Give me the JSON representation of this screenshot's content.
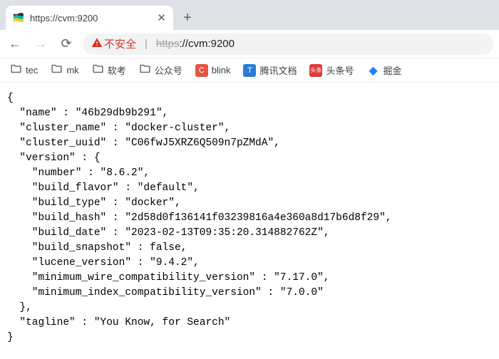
{
  "tab": {
    "title": "https://cvm:9200"
  },
  "address": {
    "warn_label": "不安全",
    "url_scheme": "https",
    "url_rest": "//cvm:9200"
  },
  "bookmarks": [
    {
      "kind": "folder",
      "label": "tec"
    },
    {
      "kind": "folder",
      "label": "mk"
    },
    {
      "kind": "folder",
      "label": "软考"
    },
    {
      "kind": "folder",
      "label": "公众号"
    },
    {
      "kind": "fav",
      "label": "blink",
      "bg": "#e25541",
      "glyph": "C"
    },
    {
      "kind": "fav",
      "label": "腾讯文档",
      "bg": "#2b7cd3",
      "glyph": "T"
    },
    {
      "kind": "fav",
      "label": "头条号",
      "bg": "#e03a3a",
      "glyph": "头条"
    },
    {
      "kind": "fav",
      "label": "掘金",
      "bg": "#1e80ff",
      "glyph": "◆"
    }
  ],
  "json_body": "{\n  \"name\" : \"46b29db9b291\",\n  \"cluster_name\" : \"docker-cluster\",\n  \"cluster_uuid\" : \"C06fwJ5XRZ6Q509n7pZMdA\",\n  \"version\" : {\n    \"number\" : \"8.6.2\",\n    \"build_flavor\" : \"default\",\n    \"build_type\" : \"docker\",\n    \"build_hash\" : \"2d58d0f136141f03239816a4e360a8d17b6d8f29\",\n    \"build_date\" : \"2023-02-13T09:35:20.314882762Z\",\n    \"build_snapshot\" : false,\n    \"lucene_version\" : \"9.4.2\",\n    \"minimum_wire_compatibility_version\" : \"7.17.0\",\n    \"minimum_index_compatibility_version\" : \"7.0.0\"\n  },\n  \"tagline\" : \"You Know, for Search\"\n}"
}
